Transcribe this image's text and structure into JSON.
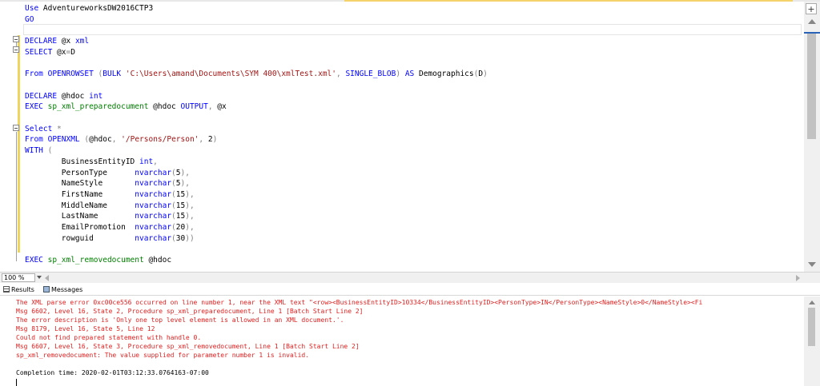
{
  "editor": {
    "lines": [
      [
        {
          "t": "Use ",
          "c": "kw"
        },
        {
          "t": "AdventureworksDW2016CTP3",
          "c": ""
        }
      ],
      [
        {
          "t": "GO",
          "c": "kw"
        }
      ],
      [
        {
          "t": "",
          "c": ""
        }
      ],
      [
        {
          "t": "DECLARE ",
          "c": "kw"
        },
        {
          "t": "@x ",
          "c": ""
        },
        {
          "t": "xml",
          "c": "kw"
        }
      ],
      [
        {
          "t": "SELECT ",
          "c": "kw"
        },
        {
          "t": "@x",
          "c": ""
        },
        {
          "t": "=",
          "c": "gr"
        },
        {
          "t": "D",
          "c": ""
        }
      ],
      [
        {
          "t": "",
          "c": ""
        }
      ],
      [
        {
          "t": "From ",
          "c": "kw"
        },
        {
          "t": "OPENROWSET ",
          "c": "kw"
        },
        {
          "t": "(",
          "c": "gr"
        },
        {
          "t": "BULK ",
          "c": "kw"
        },
        {
          "t": "'C:\\Users\\amand\\Documents\\SYM 400\\xmlTest.xml'",
          "c": "str"
        },
        {
          "t": ", ",
          "c": "gr"
        },
        {
          "t": "SINGLE_BLOB",
          "c": "kw"
        },
        {
          "t": ") ",
          "c": "gr"
        },
        {
          "t": "AS ",
          "c": "kw"
        },
        {
          "t": "Demographics",
          "c": ""
        },
        {
          "t": "(",
          "c": "gr"
        },
        {
          "t": "D",
          "c": ""
        },
        {
          "t": ")",
          "c": "gr"
        }
      ],
      [
        {
          "t": "",
          "c": ""
        }
      ],
      [
        {
          "t": "DECLARE ",
          "c": "kw"
        },
        {
          "t": "@hdoc ",
          "c": ""
        },
        {
          "t": "int",
          "c": "kw"
        }
      ],
      [
        {
          "t": "EXEC ",
          "c": "kw"
        },
        {
          "t": "sp_xml_preparedocument ",
          "c": "gr2"
        },
        {
          "t": "@hdoc ",
          "c": ""
        },
        {
          "t": "OUTPUT",
          "c": "kw"
        },
        {
          "t": ", ",
          "c": "gr"
        },
        {
          "t": "@x",
          "c": ""
        }
      ],
      [
        {
          "t": "",
          "c": ""
        }
      ],
      [
        {
          "t": "Select ",
          "c": "kw"
        },
        {
          "t": "*",
          "c": "gr"
        }
      ],
      [
        {
          "t": "From ",
          "c": "kw"
        },
        {
          "t": "OPENXML ",
          "c": "kw"
        },
        {
          "t": "(",
          "c": "gr"
        },
        {
          "t": "@hdoc",
          "c": ""
        },
        {
          "t": ", ",
          "c": "gr"
        },
        {
          "t": "'/Persons/Person'",
          "c": "str"
        },
        {
          "t": ", ",
          "c": "gr"
        },
        {
          "t": "2",
          "c": ""
        },
        {
          "t": ")",
          "c": "gr"
        }
      ],
      [
        {
          "t": "WITH ",
          "c": "kw"
        },
        {
          "t": "(",
          "c": "gr"
        }
      ],
      [
        {
          "t": "        BusinessEntityID ",
          "c": ""
        },
        {
          "t": "int",
          "c": "kw"
        },
        {
          "t": ",",
          "c": "gr"
        }
      ],
      [
        {
          "t": "        PersonType      ",
          "c": ""
        },
        {
          "t": "nvarchar",
          "c": "kw"
        },
        {
          "t": "(",
          "c": "gr"
        },
        {
          "t": "5",
          "c": ""
        },
        {
          "t": "),",
          "c": "gr"
        }
      ],
      [
        {
          "t": "        NameStyle       ",
          "c": ""
        },
        {
          "t": "nvarchar",
          "c": "kw"
        },
        {
          "t": "(",
          "c": "gr"
        },
        {
          "t": "5",
          "c": ""
        },
        {
          "t": "),",
          "c": "gr"
        }
      ],
      [
        {
          "t": "        FirstName       ",
          "c": ""
        },
        {
          "t": "nvarchar",
          "c": "kw"
        },
        {
          "t": "(",
          "c": "gr"
        },
        {
          "t": "15",
          "c": ""
        },
        {
          "t": "),",
          "c": "gr"
        }
      ],
      [
        {
          "t": "        MiddleName      ",
          "c": ""
        },
        {
          "t": "nvarchar",
          "c": "kw"
        },
        {
          "t": "(",
          "c": "gr"
        },
        {
          "t": "15",
          "c": ""
        },
        {
          "t": "),",
          "c": "gr"
        }
      ],
      [
        {
          "t": "        LastName        ",
          "c": ""
        },
        {
          "t": "nvarchar",
          "c": "kw"
        },
        {
          "t": "(",
          "c": "gr"
        },
        {
          "t": "15",
          "c": ""
        },
        {
          "t": "),",
          "c": "gr"
        }
      ],
      [
        {
          "t": "        EmailPromotion  ",
          "c": ""
        },
        {
          "t": "nvarchar",
          "c": "kw"
        },
        {
          "t": "(",
          "c": "gr"
        },
        {
          "t": "20",
          "c": ""
        },
        {
          "t": "),",
          "c": "gr"
        }
      ],
      [
        {
          "t": "        rowguid         ",
          "c": ""
        },
        {
          "t": "nvarchar",
          "c": "kw"
        },
        {
          "t": "(",
          "c": "gr"
        },
        {
          "t": "30",
          "c": ""
        },
        {
          "t": "))",
          "c": "gr"
        }
      ],
      [
        {
          "t": "",
          "c": ""
        }
      ],
      [
        {
          "t": "EXEC ",
          "c": "kw"
        },
        {
          "t": "sp_xml_removedocument ",
          "c": "gr2"
        },
        {
          "t": "@hdoc",
          "c": ""
        }
      ]
    ]
  },
  "zoom": {
    "value": "100 %"
  },
  "tabs": {
    "results": "Results",
    "messages": "Messages"
  },
  "messages": {
    "lines": [
      "The XML parse error 0xc00ce556 occurred on line number 1, near the XML text \"<row><BusinessEntityID>10334</BusinessEntityID><PersonType>IN</PersonType><NameStyle>0</NameStyle><Fi",
      "Msg 6602, Level 16, State 2, Procedure sp_xml_preparedocument, Line 1 [Batch Start Line 2]",
      "The error description is 'Only one top level element is allowed in an XML document.'.",
      "Msg 8179, Level 16, State 5, Line 12",
      "Could not find prepared statement with handle 0.",
      "Msg 6607, Level 16, State 3, Procedure sp_xml_removedocument, Line 1 [Batch Start Line 2]",
      "sp_xml_removedocument: The value supplied for parameter number 1 is invalid.",
      "",
      "Completion time: 2020-02-01T03:12:33.0764163-07:00"
    ]
  }
}
